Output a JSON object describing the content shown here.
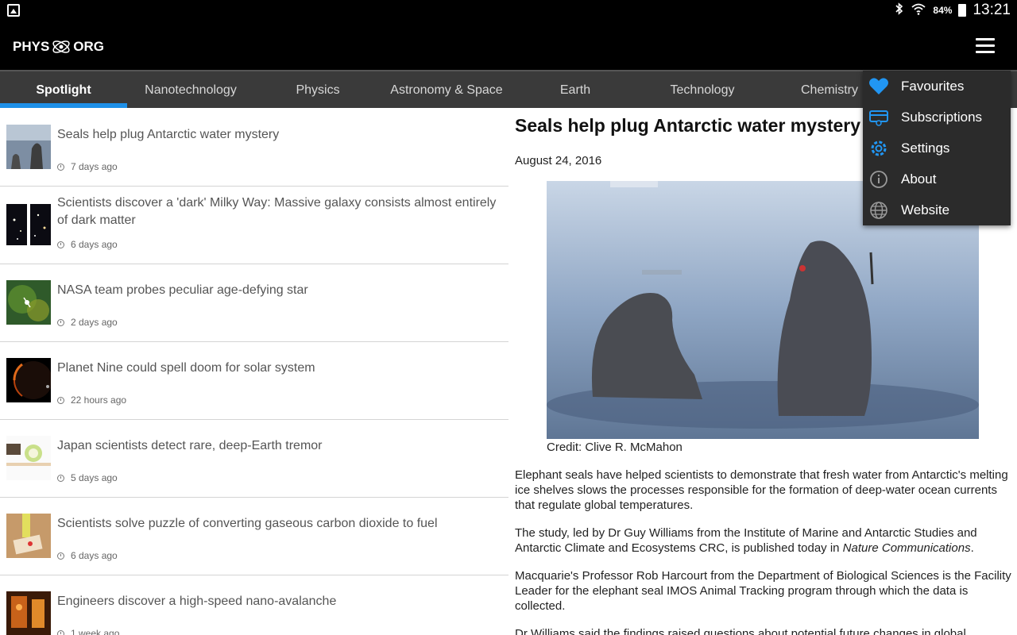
{
  "status_bar": {
    "battery": "84%",
    "time": "13:21"
  },
  "app": {
    "logo_left": "PHYS",
    "logo_right": "ORG"
  },
  "tabs": [
    {
      "label": "Spotlight",
      "active": true
    },
    {
      "label": "Nanotechnology",
      "active": false
    },
    {
      "label": "Physics",
      "active": false
    },
    {
      "label": "Astronomy & Space",
      "active": false
    },
    {
      "label": "Earth",
      "active": false
    },
    {
      "label": "Technology",
      "active": false
    },
    {
      "label": "Chemistry",
      "active": false
    }
  ],
  "articles": [
    {
      "title": "Seals help plug Antarctic water mystery",
      "time": "7 days ago"
    },
    {
      "title": "Scientists discover a 'dark' Milky Way: Massive galaxy consists almost entirely of dark matter",
      "time": "6 days ago"
    },
    {
      "title": "NASA team probes peculiar age-defying star",
      "time": "2 days ago"
    },
    {
      "title": "Planet Nine could spell doom for solar system",
      "time": "22 hours ago"
    },
    {
      "title": "Japan scientists detect rare, deep-Earth tremor",
      "time": "5 days ago"
    },
    {
      "title": "Scientists solve puzzle of converting gaseous carbon dioxide to fuel",
      "time": "6 days ago"
    },
    {
      "title": "Engineers discover a high-speed nano-avalanche",
      "time": "1 week ago"
    }
  ],
  "detail": {
    "title": "Seals help plug Antarctic water mystery",
    "date": "August 24, 2016",
    "credit": "Credit: Clive R. McMahon",
    "p1": "Elephant seals have helped scientists to demonstrate that fresh water from Antarctic's melting ice shelves slows the processes responsible for the formation of deep-water ocean currents that regulate global temperatures.",
    "p2_before": "The study, led by Dr Guy Williams from the Institute of Marine and Antarctic Studies and Antarctic Climate and Ecosystems CRC, is published today in ",
    "p2_italic": "Nature Communications",
    "p2_after": ".",
    "p3": "Macquarie's Professor Rob Harcourt from the Department of Biological Sciences is the Facility Leader for the elephant seal IMOS Animal Tracking program through which the data is collected.",
    "p4": "Dr Williams said the findings raised questions about potential future changes in global"
  },
  "menu": [
    {
      "label": "Favourites",
      "icon": "heart-icon"
    },
    {
      "label": "Subscriptions",
      "icon": "subscriptions-icon"
    },
    {
      "label": "Settings",
      "icon": "gear-icon"
    },
    {
      "label": "About",
      "icon": "info-icon"
    },
    {
      "label": "Website",
      "icon": "globe-icon"
    }
  ],
  "colors": {
    "accent": "#1e90e8",
    "tab_bar": "#3a3a3a",
    "menu_bg": "#2b2b2b"
  }
}
